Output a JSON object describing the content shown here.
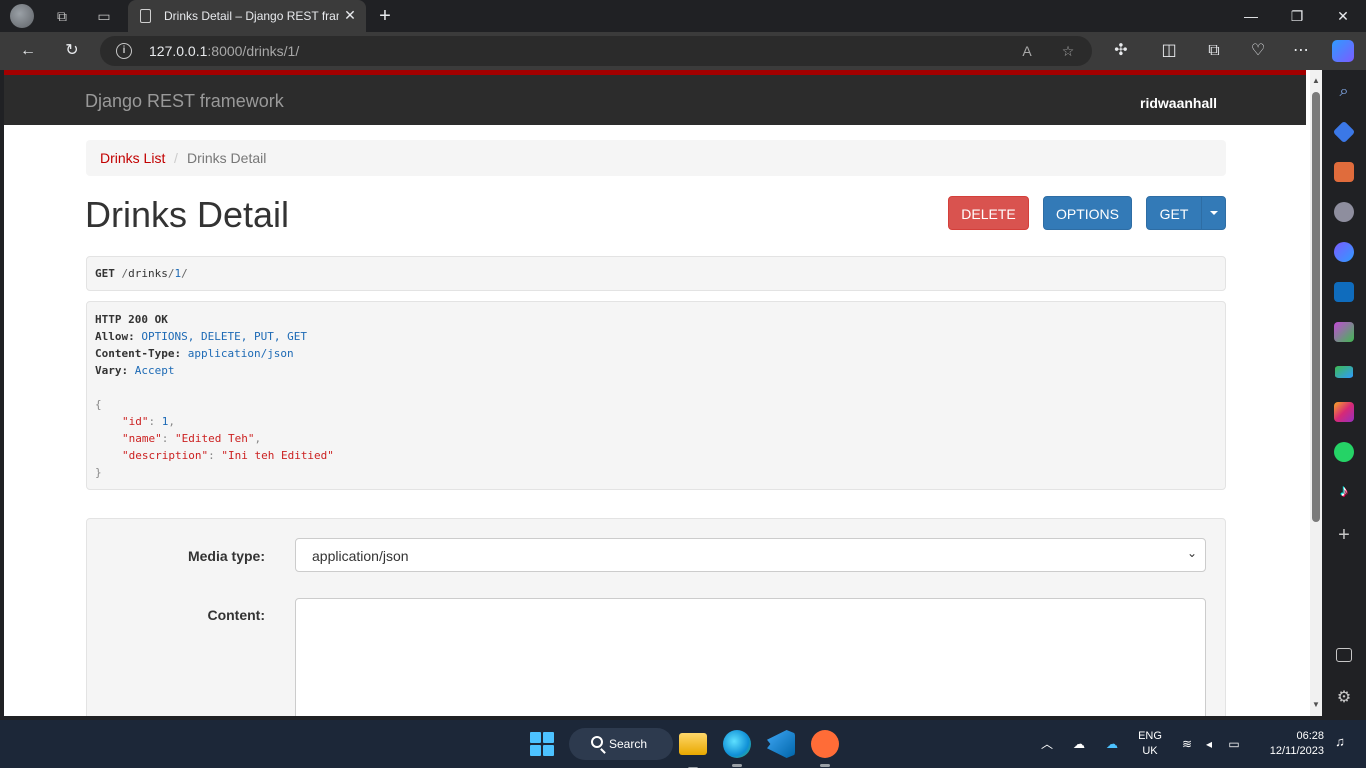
{
  "browser": {
    "tab_title": "Drinks Detail – Django REST framework",
    "address_host": "127.0.0.1",
    "address_path": ":8000/drinks/1/"
  },
  "page": {
    "brand": "Django REST framework",
    "user": "ridwaanhall",
    "breadcrumb": {
      "link": "Drinks List",
      "separator": "/",
      "active": "Drinks Detail"
    },
    "title": "Drinks Detail",
    "buttons": {
      "delete": "DELETE",
      "options": "OPTIONS",
      "get": "GET"
    },
    "request": {
      "method": "GET",
      "path_prefix": "/",
      "path_segment": "drinks",
      "path_sep": "/",
      "path_id": "1",
      "path_end": "/"
    },
    "response": {
      "status": "HTTP 200 OK",
      "headers": [
        {
          "key": "Allow:",
          "value": "OPTIONS, DELETE, PUT, GET"
        },
        {
          "key": "Content-Type:",
          "value": "application/json"
        },
        {
          "key": "Vary:",
          "value": "Accept"
        }
      ],
      "open_brace": "{",
      "close_brace": "}",
      "fields": [
        {
          "key": "\"id\"",
          "value": "1",
          "type": "num",
          "comma": ","
        },
        {
          "key": "\"name\"",
          "value": "\"Edited Teh\"",
          "type": "str",
          "comma": ","
        },
        {
          "key": "\"description\"",
          "value": "\"Ini teh Editied\"",
          "type": "str",
          "comma": ""
        }
      ]
    },
    "form": {
      "media_type_label": "Media type:",
      "media_type_value": "application/json",
      "content_label": "Content:"
    }
  },
  "taskbar": {
    "search_label": "Search",
    "lang_top": "ENG",
    "lang_bottom": "UK",
    "time": "06:28",
    "date": "12/11/2023"
  }
}
